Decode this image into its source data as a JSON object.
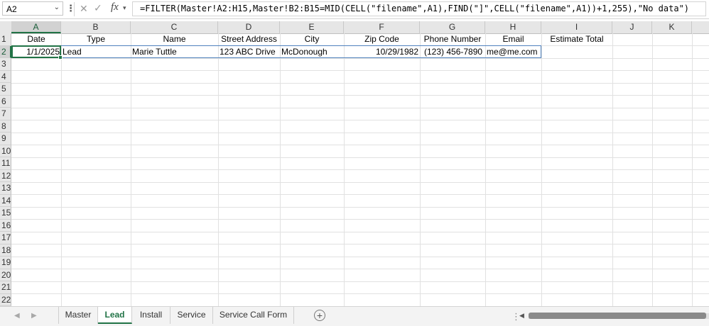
{
  "formula_bar": {
    "name_box": "A2",
    "fx": "fx",
    "formula": "=FILTER(Master!A2:H15,Master!B2:B15=MID(CELL(\"filename\",A1),FIND(\"]\",CELL(\"filename\",A1))+1,255),\"No data\")"
  },
  "columns": [
    {
      "letter": "A"
    },
    {
      "letter": "B"
    },
    {
      "letter": "C"
    },
    {
      "letter": "D"
    },
    {
      "letter": "E"
    },
    {
      "letter": "F"
    },
    {
      "letter": "G"
    },
    {
      "letter": "H"
    },
    {
      "letter": "I"
    },
    {
      "letter": "J"
    },
    {
      "letter": "K"
    }
  ],
  "rows": [
    "1",
    "2",
    "3",
    "4",
    "5",
    "6",
    "7",
    "8",
    "9",
    "10",
    "11",
    "12",
    "13",
    "14",
    "15",
    "16",
    "17",
    "18",
    "19",
    "20",
    "21",
    "22"
  ],
  "header_row": {
    "date": "Date",
    "type": "Type",
    "name": "Name",
    "street": "Street Address",
    "city": "City",
    "zip": "Zip Code",
    "phone": "Phone Number",
    "email": "Email",
    "estimate": "Estimate Total"
  },
  "data_row": {
    "date": "1/1/2025",
    "type": "Lead",
    "name": "Marie Tuttle",
    "street": "123 ABC Drive",
    "city": "McDonough",
    "zip": "10/29/1982",
    "phone": "(123) 456-7890",
    "email": "me@me.com"
  },
  "sheet_tabs": [
    "Master",
    "Lead",
    "Install",
    "Service",
    "Service Call Form"
  ],
  "active_sheet": "Lead",
  "colors": {
    "accent": "#217346",
    "spill_border": "#4f81bd"
  }
}
